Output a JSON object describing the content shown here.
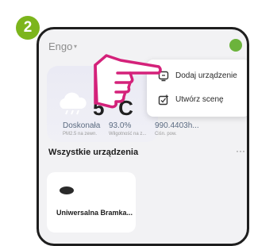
{
  "step": "2",
  "header": {
    "home_name": "Engo",
    "caret": "▾"
  },
  "weather": {
    "temperature": "5 °C",
    "condition": "Doskonała",
    "condition_sub": "PM2.5 na zewn.",
    "humidity_value": "93.0%",
    "humidity_label": "Wilgotność na z...",
    "pressure_value": "990.4403h...",
    "pressure_label": "Ciśn. pow."
  },
  "menu": {
    "items": [
      {
        "label": "Dodaj urządzenie",
        "icon": "add-device-icon"
      },
      {
        "label": "Utwórz scenę",
        "icon": "create-scene-icon"
      }
    ]
  },
  "devices": {
    "title": "Wszystkie urządzenia",
    "more": "···",
    "items": [
      {
        "name": "Uniwersalna Bramka..."
      }
    ]
  },
  "colors": {
    "accent": "#7cb51c",
    "hand_outline": "#d4217a"
  }
}
